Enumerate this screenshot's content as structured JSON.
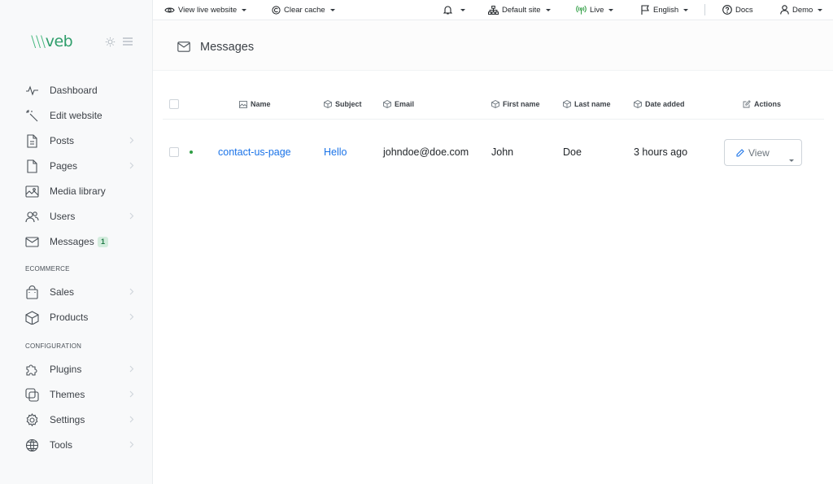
{
  "app": {
    "logo_slashes": "\\\\\\",
    "logo_brand": "veb"
  },
  "topbar": {
    "view_live": "View live website",
    "clear_cache": "Clear cache",
    "default_site": "Default site",
    "live": "Live",
    "language": "English",
    "docs": "Docs",
    "user": "Demo"
  },
  "sidebar": {
    "items": [
      {
        "label": "Dashboard",
        "icon": "activity-icon"
      },
      {
        "label": "Edit website",
        "icon": "magic-wand-icon"
      },
      {
        "label": "Posts",
        "icon": "file-text-icon",
        "has_children": true
      },
      {
        "label": "Pages",
        "icon": "file-icon",
        "has_children": true
      },
      {
        "label": "Media library",
        "icon": "image-gallery-icon"
      },
      {
        "label": "Users",
        "icon": "users-icon",
        "has_children": true
      },
      {
        "label": "Messages",
        "icon": "envelope-icon",
        "badge": "1"
      }
    ],
    "sections": {
      "ecommerce": "ECOMMERCE",
      "configuration": "CONFIGURATION"
    },
    "ecommerce_items": [
      {
        "label": "Sales",
        "icon": "shopping-bag-icon",
        "has_children": true
      },
      {
        "label": "Products",
        "icon": "box-icon",
        "has_children": true
      }
    ],
    "config_items": [
      {
        "label": "Plugins",
        "icon": "puzzle-icon",
        "has_children": true
      },
      {
        "label": "Themes",
        "icon": "layers-icon",
        "has_children": true
      },
      {
        "label": "Settings",
        "icon": "gear-icon",
        "has_children": true
      },
      {
        "label": "Tools",
        "icon": "globe-icon",
        "has_children": true
      }
    ]
  },
  "page": {
    "title": "Messages"
  },
  "table": {
    "headers": {
      "name": "Name",
      "subject": "Subject",
      "email": "Email",
      "first_name": "First name",
      "last_name": "Last name",
      "date_added": "Date added",
      "actions": "Actions"
    },
    "rows": [
      {
        "name": "contact-us-page",
        "subject": "Hello",
        "email": "johndoe@doe.com",
        "first_name": "John",
        "last_name": "Doe",
        "date_added": "3 hours ago",
        "action": "View"
      }
    ]
  },
  "colors": {
    "accent": "#2f9e6b",
    "link": "#1a73e8",
    "status_dot": "#2f9e44"
  }
}
